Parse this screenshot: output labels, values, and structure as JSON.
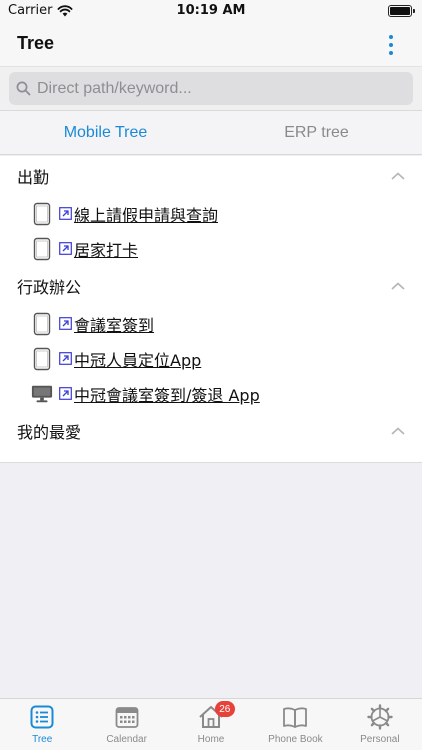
{
  "status_bar": {
    "carrier": "Carrier",
    "time": "10:19 AM",
    "battery_level": 1.0
  },
  "header": {
    "title": "Tree",
    "menu_icon": "more-vertical-icon"
  },
  "search": {
    "placeholder": "Direct path/keyword...",
    "value": ""
  },
  "tabs": [
    {
      "label": "Mobile Tree",
      "active": true
    },
    {
      "label": "ERP tree",
      "active": false
    }
  ],
  "sections": [
    {
      "title": "出勤",
      "expanded": true,
      "items": [
        {
          "label": "線上請假申請與查詢",
          "device": "tablet-icon"
        },
        {
          "label": "居家打卡",
          "device": "tablet-icon"
        }
      ]
    },
    {
      "title": "行政辦公",
      "expanded": true,
      "items": [
        {
          "label": "會議室簽到",
          "device": "tablet-icon"
        },
        {
          "label": "中冠人員定位App",
          "device": "tablet-icon"
        },
        {
          "label": "中冠會議室簽到/簽退 App",
          "device": "desktop-icon"
        }
      ]
    },
    {
      "title": "我的最愛",
      "expanded": true,
      "items": []
    }
  ],
  "tab_bar": [
    {
      "label": "Tree",
      "icon": "list-icon",
      "active": true
    },
    {
      "label": "Calendar",
      "icon": "calendar-icon",
      "active": false
    },
    {
      "label": "Home",
      "icon": "home-icon",
      "active": false,
      "badge": "26"
    },
    {
      "label": "Phone Book",
      "icon": "book-icon",
      "active": false
    },
    {
      "label": "Personal",
      "icon": "gear-icon",
      "active": false
    }
  ],
  "colors": {
    "accent": "#1a8ad6",
    "badge": "#e8413a",
    "inactive": "#8a8a8a"
  }
}
